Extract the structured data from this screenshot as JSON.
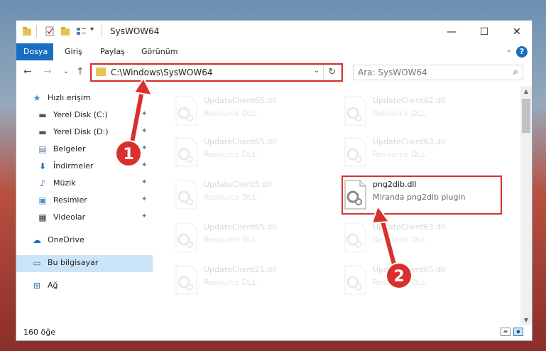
{
  "window": {
    "title": "SysWOW64",
    "controls": {
      "minimize": "—",
      "maximize": "☐",
      "close": "✕"
    }
  },
  "ribbon": {
    "tabs": [
      {
        "label": "Dosya",
        "active": true
      },
      {
        "label": "Giriş",
        "active": false
      },
      {
        "label": "Paylaş",
        "active": false
      },
      {
        "label": "Görünüm",
        "active": false
      }
    ],
    "help_glyph": "?",
    "expand_glyph": "⌄"
  },
  "nav": {
    "back": "←",
    "forward": "→",
    "recent": "⌄",
    "up": "↑",
    "address": "C:\\Windows\\SysWOW64",
    "address_dropdown": "⌄",
    "refresh": "↻",
    "search_placeholder": "Ara: SysWOW64",
    "search_glyph": "⌕"
  },
  "sidebar": {
    "items": [
      {
        "label": "Hızlı erişim",
        "icon": "star-icon",
        "glyph": "★",
        "color": "#3d8bd6",
        "pinned": false,
        "selected": false
      },
      {
        "label": "Yerel Disk (C:)",
        "icon": "drive-icon",
        "glyph": "▬",
        "color": "#555555",
        "pinned": true,
        "selected": false
      },
      {
        "label": "Yerel Disk (D:)",
        "icon": "drive-icon",
        "glyph": "▬",
        "color": "#555555",
        "pinned": true,
        "selected": false
      },
      {
        "label": "Belgeler",
        "icon": "documents-icon",
        "glyph": "▤",
        "color": "#5b7fa6",
        "pinned": true,
        "selected": false
      },
      {
        "label": "İndirmeler",
        "icon": "download-icon",
        "glyph": "⬇",
        "color": "#1a6ec0",
        "pinned": true,
        "selected": false
      },
      {
        "label": "Müzik",
        "icon": "music-icon",
        "glyph": "♪",
        "color": "#1a6ec0",
        "pinned": true,
        "selected": false
      },
      {
        "label": "Resimler",
        "icon": "pictures-icon",
        "glyph": "▣",
        "color": "#4a90c8",
        "pinned": true,
        "selected": false
      },
      {
        "label": "Videolar",
        "icon": "video-icon",
        "glyph": "▦",
        "color": "#333333",
        "pinned": true,
        "selected": false
      },
      {
        "label": "OneDrive",
        "icon": "cloud-icon",
        "glyph": "☁",
        "color": "#1a6ec0",
        "pinned": false,
        "selected": false
      },
      {
        "label": "Bu bilgisayar",
        "icon": "computer-icon",
        "glyph": "▭",
        "color": "#2f7cc1",
        "pinned": false,
        "selected": true
      },
      {
        "label": "Ağ",
        "icon": "network-icon",
        "glyph": "⊞",
        "color": "#2f7cc1",
        "pinned": false,
        "selected": false
      }
    ],
    "pin_glyph": "📌"
  },
  "files": [
    {
      "name": "UpdateClient65.dll",
      "desc": "Resource DLL",
      "faded": true
    },
    {
      "name": "UpdateClient42.dll",
      "desc": "Resource DLL",
      "faded": true
    },
    {
      "name": "UpdateClient65.dll",
      "desc": "Resource DLL",
      "faded": true
    },
    {
      "name": "UpdateClient63.dll",
      "desc": "Resource DLL",
      "faded": true
    },
    {
      "name": "UpdateClient5.dll",
      "desc": "Resource DLL",
      "faded": true
    },
    {
      "name": "png2dib.dll",
      "desc": "Miranda png2dib plugin",
      "faded": false
    },
    {
      "name": "UpdateClient65.dll",
      "desc": "Resource DLL",
      "faded": true
    },
    {
      "name": "UpdateClient63.dll",
      "desc": "Resource DLL",
      "faded": true
    },
    {
      "name": "UpdateClient21.dll",
      "desc": "Resource DLL",
      "faded": true
    },
    {
      "name": "UpdateClient65.dll",
      "desc": "Resource DLL",
      "faded": true
    }
  ],
  "status": {
    "count": "160 öğe"
  },
  "callouts": [
    {
      "label": "1"
    },
    {
      "label": "2"
    }
  ],
  "colors": {
    "accent": "#1a6ec0",
    "highlight": "#d9302f",
    "selected": "#cce4f7"
  }
}
